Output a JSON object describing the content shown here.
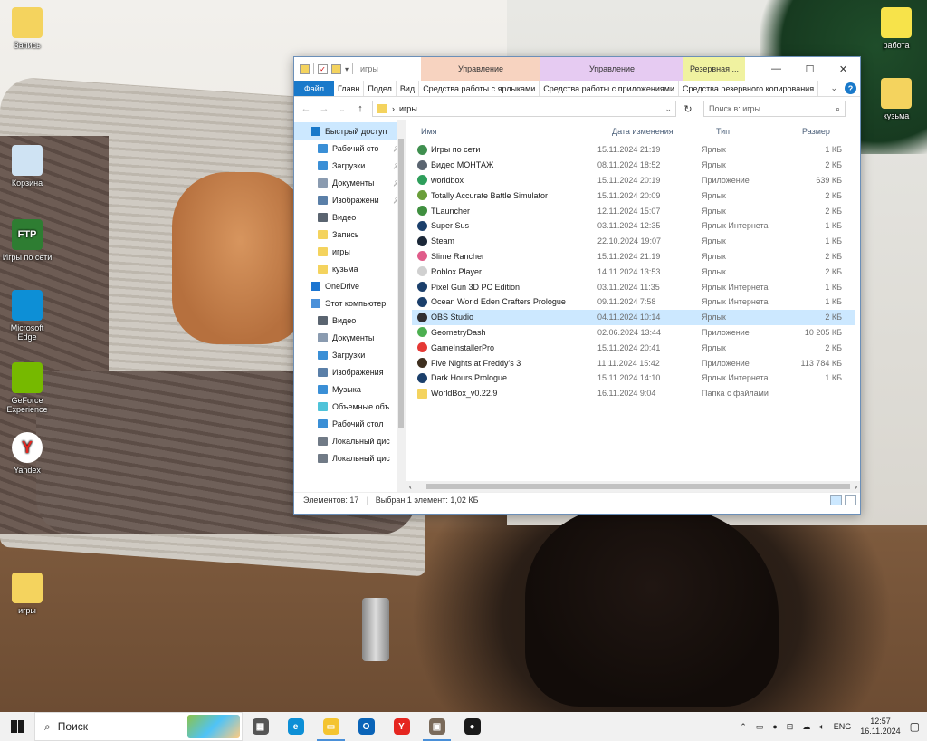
{
  "desktop": {
    "icons_left": [
      {
        "label": "Запись",
        "color": "#f4d35e",
        "glyph": "folder"
      },
      {
        "label": "Корзина",
        "color": "#cfe3f3",
        "glyph": "recycle-bin"
      },
      {
        "label": "Игры по сети",
        "color": "#2e7d32",
        "glyph": "FTP"
      },
      {
        "label": "Microsoft Edge",
        "color": "#0d8fd6",
        "glyph": "edge"
      },
      {
        "label": "GeForce Experience",
        "color": "#76b900",
        "glyph": "nvidia"
      },
      {
        "label": "Yandex",
        "color": "#ffffff",
        "glyph": "Y"
      },
      {
        "label": "игры",
        "color": "#f4d35e",
        "glyph": "folder-archive"
      }
    ],
    "icons_right": [
      {
        "label": "работа",
        "color": "#f7e34a",
        "glyph": "folder-e"
      },
      {
        "label": "кузьма",
        "color": "#f4d35e",
        "glyph": "folder"
      }
    ]
  },
  "explorer": {
    "title": "игры",
    "context_tabs": [
      {
        "label": "Управление",
        "color": "#f7d3c0"
      },
      {
        "label": "Управление",
        "color": "#e6cbf2"
      },
      {
        "label": "Резервная ...",
        "color": "#f0f2a0"
      }
    ],
    "ribbon": {
      "file": "Файл",
      "tabs": [
        "Главн",
        "Подел",
        "Вид",
        "Средства работы с ярлыками",
        "Средства работы с приложениями",
        "Средства резервного копирования"
      ]
    },
    "address": {
      "path_sep": "›",
      "path": "игры",
      "search_placeholder": "Поиск в: игры"
    },
    "nav": [
      {
        "label": "Быстрый доступ",
        "color": "#1979ca",
        "selected": true,
        "pinned": false,
        "indent": 0
      },
      {
        "label": "Рабочий сто",
        "color": "#3a8fd6",
        "selected": false,
        "pinned": true,
        "indent": 1
      },
      {
        "label": "Загрузки",
        "color": "#3a8fd6",
        "selected": false,
        "pinned": true,
        "indent": 1
      },
      {
        "label": "Документы",
        "color": "#8a9bb0",
        "selected": false,
        "pinned": true,
        "indent": 1
      },
      {
        "label": "Изображени",
        "color": "#5a7fa8",
        "selected": false,
        "pinned": true,
        "indent": 1
      },
      {
        "label": "Видео",
        "color": "#5a6470",
        "selected": false,
        "pinned": false,
        "indent": 1
      },
      {
        "label": "Запись",
        "color": "#f4d35e",
        "selected": false,
        "pinned": false,
        "indent": 1
      },
      {
        "label": "игры",
        "color": "#f4d35e",
        "selected": false,
        "pinned": false,
        "indent": 1
      },
      {
        "label": "кузьма",
        "color": "#f4d35e",
        "selected": false,
        "pinned": false,
        "indent": 1
      },
      {
        "label": "OneDrive",
        "color": "#1b75d1",
        "selected": false,
        "pinned": false,
        "indent": 0
      },
      {
        "label": "Этот компьютер",
        "color": "#4a90d9",
        "selected": false,
        "pinned": false,
        "indent": 0
      },
      {
        "label": "Видео",
        "color": "#5a6470",
        "selected": false,
        "pinned": false,
        "indent": 1
      },
      {
        "label": "Документы",
        "color": "#8a9bb0",
        "selected": false,
        "pinned": false,
        "indent": 1
      },
      {
        "label": "Загрузки",
        "color": "#3a8fd6",
        "selected": false,
        "pinned": false,
        "indent": 1
      },
      {
        "label": "Изображения",
        "color": "#5a7fa8",
        "selected": false,
        "pinned": false,
        "indent": 1
      },
      {
        "label": "Музыка",
        "color": "#3a8fd6",
        "selected": false,
        "pinned": false,
        "indent": 1
      },
      {
        "label": "Объемные объ",
        "color": "#4fc3d9",
        "selected": false,
        "pinned": false,
        "indent": 1
      },
      {
        "label": "Рабочий стол",
        "color": "#3a8fd6",
        "selected": false,
        "pinned": false,
        "indent": 1
      },
      {
        "label": "Локальный дис",
        "color": "#707a86",
        "selected": false,
        "pinned": false,
        "indent": 1
      },
      {
        "label": "Локальный дис",
        "color": "#707a86",
        "selected": false,
        "pinned": false,
        "indent": 1
      }
    ],
    "columns": [
      "Имя",
      "Дата изменения",
      "Тип",
      "Размер"
    ],
    "files": [
      {
        "name": "Игры по сети",
        "date": "15.11.2024 21:19",
        "type": "Ярлык",
        "size": "1 КБ",
        "icon": "#3f8f4f",
        "selected": false
      },
      {
        "name": "Видео МОНТАЖ",
        "date": "08.11.2024 18:52",
        "type": "Ярлык",
        "size": "2 КБ",
        "icon": "#5a6470",
        "selected": false
      },
      {
        "name": "worldbox",
        "date": "15.11.2024 20:19",
        "type": "Приложение",
        "size": "639 КБ",
        "icon": "#2e9e5b",
        "selected": false
      },
      {
        "name": "Totally Accurate Battle Simulator",
        "date": "15.11.2024 20:09",
        "type": "Ярлык",
        "size": "2 КБ",
        "icon": "#6a9e3a",
        "selected": false
      },
      {
        "name": "TLauncher",
        "date": "12.11.2024 15:07",
        "type": "Ярлык",
        "size": "2 КБ",
        "icon": "#3f8f3f",
        "selected": false
      },
      {
        "name": "Super Sus",
        "date": "03.11.2024 12:35",
        "type": "Ярлык Интернета",
        "size": "1 КБ",
        "icon": "#1b3f6b",
        "selected": false
      },
      {
        "name": "Steam",
        "date": "22.10.2024 19:07",
        "type": "Ярлык",
        "size": "1 КБ",
        "icon": "#1b2838",
        "selected": false
      },
      {
        "name": "Slime Rancher",
        "date": "15.11.2024 21:19",
        "type": "Ярлык",
        "size": "2 КБ",
        "icon": "#e05c8a",
        "selected": false
      },
      {
        "name": "Roblox Player",
        "date": "14.11.2024 13:53",
        "type": "Ярлык",
        "size": "2 КБ",
        "icon": "#d0d0d0",
        "selected": false
      },
      {
        "name": "Pixel Gun 3D PC Edition",
        "date": "03.11.2024 11:35",
        "type": "Ярлык Интернета",
        "size": "1 КБ",
        "icon": "#1b3f6b",
        "selected": false
      },
      {
        "name": "Ocean World Eden Crafters Prologue",
        "date": "09.11.2024 7:58",
        "type": "Ярлык Интернета",
        "size": "1 КБ",
        "icon": "#1b3f6b",
        "selected": false
      },
      {
        "name": "OBS Studio",
        "date": "04.11.2024 10:14",
        "type": "Ярлык",
        "size": "2 КБ",
        "icon": "#302e31",
        "selected": true
      },
      {
        "name": "GeometryDash",
        "date": "02.06.2024 13:44",
        "type": "Приложение",
        "size": "10 205 КБ",
        "icon": "#4caf50",
        "selected": false
      },
      {
        "name": "GameInstallerPro",
        "date": "15.11.2024 20:41",
        "type": "Ярлык",
        "size": "2 КБ",
        "icon": "#e53935",
        "selected": false
      },
      {
        "name": "Five Nights at Freddy's 3",
        "date": "11.11.2024 15:42",
        "type": "Приложение",
        "size": "113 784 КБ",
        "icon": "#3e2f1f",
        "selected": false
      },
      {
        "name": "Dark Hours Prologue",
        "date": "15.11.2024 14:10",
        "type": "Ярлык Интернета",
        "size": "1 КБ",
        "icon": "#1b3f6b",
        "selected": false
      },
      {
        "name": "WorldBox_v0.22.9",
        "date": "16.11.2024 9:04",
        "type": "Папка с файлами",
        "size": "",
        "icon": "#f4d35e",
        "selected": false
      }
    ],
    "status": {
      "count": "Элементов: 17",
      "selection": "Выбран 1 элемент: 1,02 КБ"
    }
  },
  "taskbar": {
    "search_label": "Поиск",
    "apps": [
      {
        "name": "task-view",
        "color": "#555555",
        "glyph": "▦",
        "active": false
      },
      {
        "name": "edge",
        "color": "#0d8fd6",
        "glyph": "e",
        "active": false
      },
      {
        "name": "file-explorer",
        "color": "#f4c430",
        "glyph": "▭",
        "active": true
      },
      {
        "name": "outlook",
        "color": "#0a64b8",
        "glyph": "O",
        "active": false
      },
      {
        "name": "yandex",
        "color": "#e52620",
        "glyph": "Y",
        "active": false
      },
      {
        "name": "image-viewer",
        "color": "#7a6a5a",
        "glyph": "▣",
        "active": true
      },
      {
        "name": "obs",
        "color": "#1a1a1a",
        "glyph": "●",
        "active": false
      }
    ],
    "tray": {
      "language": "ENG",
      "time": "12:57",
      "date": "16.11.2024"
    }
  }
}
